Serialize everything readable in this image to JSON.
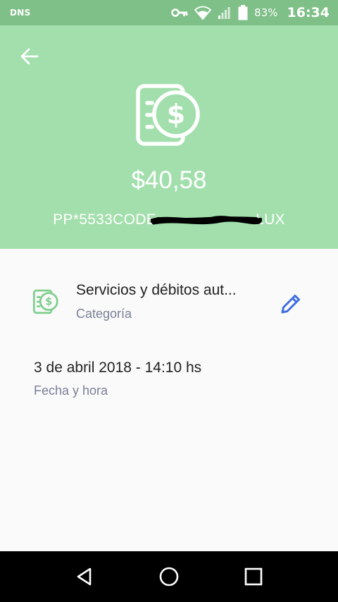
{
  "status_bar": {
    "carrier": "DNS",
    "battery_percent": "83%",
    "time": "16:34",
    "icons": [
      "vpn-key-icon",
      "wifi-icon",
      "signal-icon",
      "battery-icon"
    ]
  },
  "header": {
    "background_color": "#a2dfac",
    "icon": "receipt-dollar-icon",
    "amount": "$40,58",
    "merchant": "PP*5533CODE                       LUX"
  },
  "category": {
    "icon": "receipt-dollar-icon",
    "name": "Servicios y débitos aut...",
    "label": "Categoría",
    "edit_icon": "pencil-icon",
    "accent_color": "#3f6ee0"
  },
  "datetime": {
    "value": "3 de abril 2018 - 14:10 hs",
    "label": "Fecha y hora"
  },
  "nav_bar": {
    "buttons": [
      "back-triangle-icon",
      "home-circle-icon",
      "recents-square-icon"
    ]
  }
}
